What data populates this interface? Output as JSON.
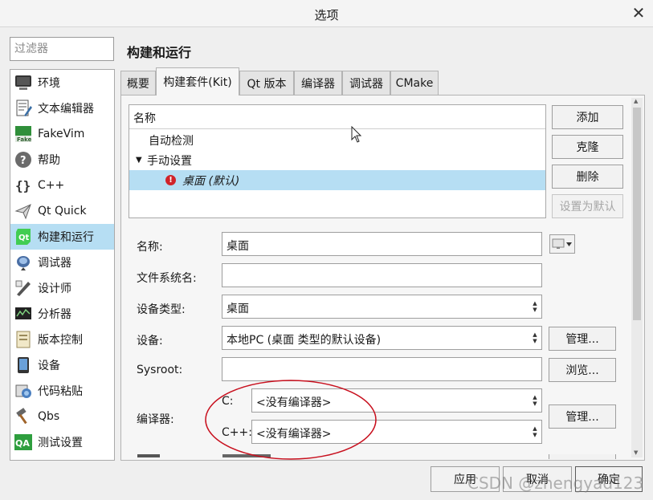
{
  "window": {
    "title": "选项",
    "close_glyph": "✕"
  },
  "filter": {
    "placeholder": "过滤器",
    "value": ""
  },
  "sidebar": {
    "items": [
      {
        "label": "环境",
        "icon": "monitor-icon"
      },
      {
        "label": "文本编辑器",
        "icon": "text-editor-icon"
      },
      {
        "label": "FakeVim",
        "icon": "fakevim-icon"
      },
      {
        "label": "帮助",
        "icon": "help-icon"
      },
      {
        "label": "C++",
        "icon": "cpp-braces-icon"
      },
      {
        "label": "Qt Quick",
        "icon": "qt-quick-icon"
      },
      {
        "label": "构建和运行",
        "icon": "qt-build-run-icon",
        "selected": true
      },
      {
        "label": "调试器",
        "icon": "debugger-icon"
      },
      {
        "label": "设计师",
        "icon": "designer-icon"
      },
      {
        "label": "分析器",
        "icon": "analyzer-icon"
      },
      {
        "label": "版本控制",
        "icon": "version-control-icon"
      },
      {
        "label": "设备",
        "icon": "device-icon"
      },
      {
        "label": "代码粘贴",
        "icon": "code-paste-icon"
      },
      {
        "label": "Qbs",
        "icon": "qbs-hammer-icon"
      },
      {
        "label": "测试设置",
        "icon": "qa-test-icon"
      }
    ]
  },
  "page": {
    "heading": "构建和运行"
  },
  "tabs": [
    {
      "label": "概要"
    },
    {
      "label": "构建套件(Kit)",
      "active": true
    },
    {
      "label": "Qt 版本"
    },
    {
      "label": "编译器"
    },
    {
      "label": "调试器"
    },
    {
      "label": "CMake"
    }
  ],
  "kit_tree": {
    "header": "名称",
    "auto_detected": "自动检测",
    "manual": "手动设置",
    "manual_arrow": "▼",
    "kit_name": "桌面 (默认)",
    "warning_glyph": "!"
  },
  "kit_buttons": {
    "add": "添加",
    "clone": "克隆",
    "remove": "删除",
    "make_default": "设置为默认"
  },
  "form": {
    "name_label": "名称:",
    "name_value": "桌面",
    "fs_name_label": "文件系统名:",
    "fs_name_value": "",
    "device_type_label": "设备类型:",
    "device_type_value": "桌面",
    "device_label": "设备:",
    "device_value": "本地PC (桌面 类型的默认设备)",
    "manage_label": "管理...",
    "sysroot_label": "Sysroot:",
    "sysroot_value": "",
    "browse_label": "浏览...",
    "compiler_label": "编译器:",
    "c_label": "C:",
    "c_value": "<没有编译器>",
    "cpp_label": "C++:",
    "cpp_value": "<没有编译器>",
    "compiler_manage_label": "管理..."
  },
  "footer": {
    "apply": "应用",
    "cancel": "取消",
    "ok": "确定"
  },
  "watermark": "CSDN @zhengyad123",
  "colors": {
    "selection": "#b6def3",
    "annotation": "#c8101e",
    "warning": "#d0232a"
  }
}
